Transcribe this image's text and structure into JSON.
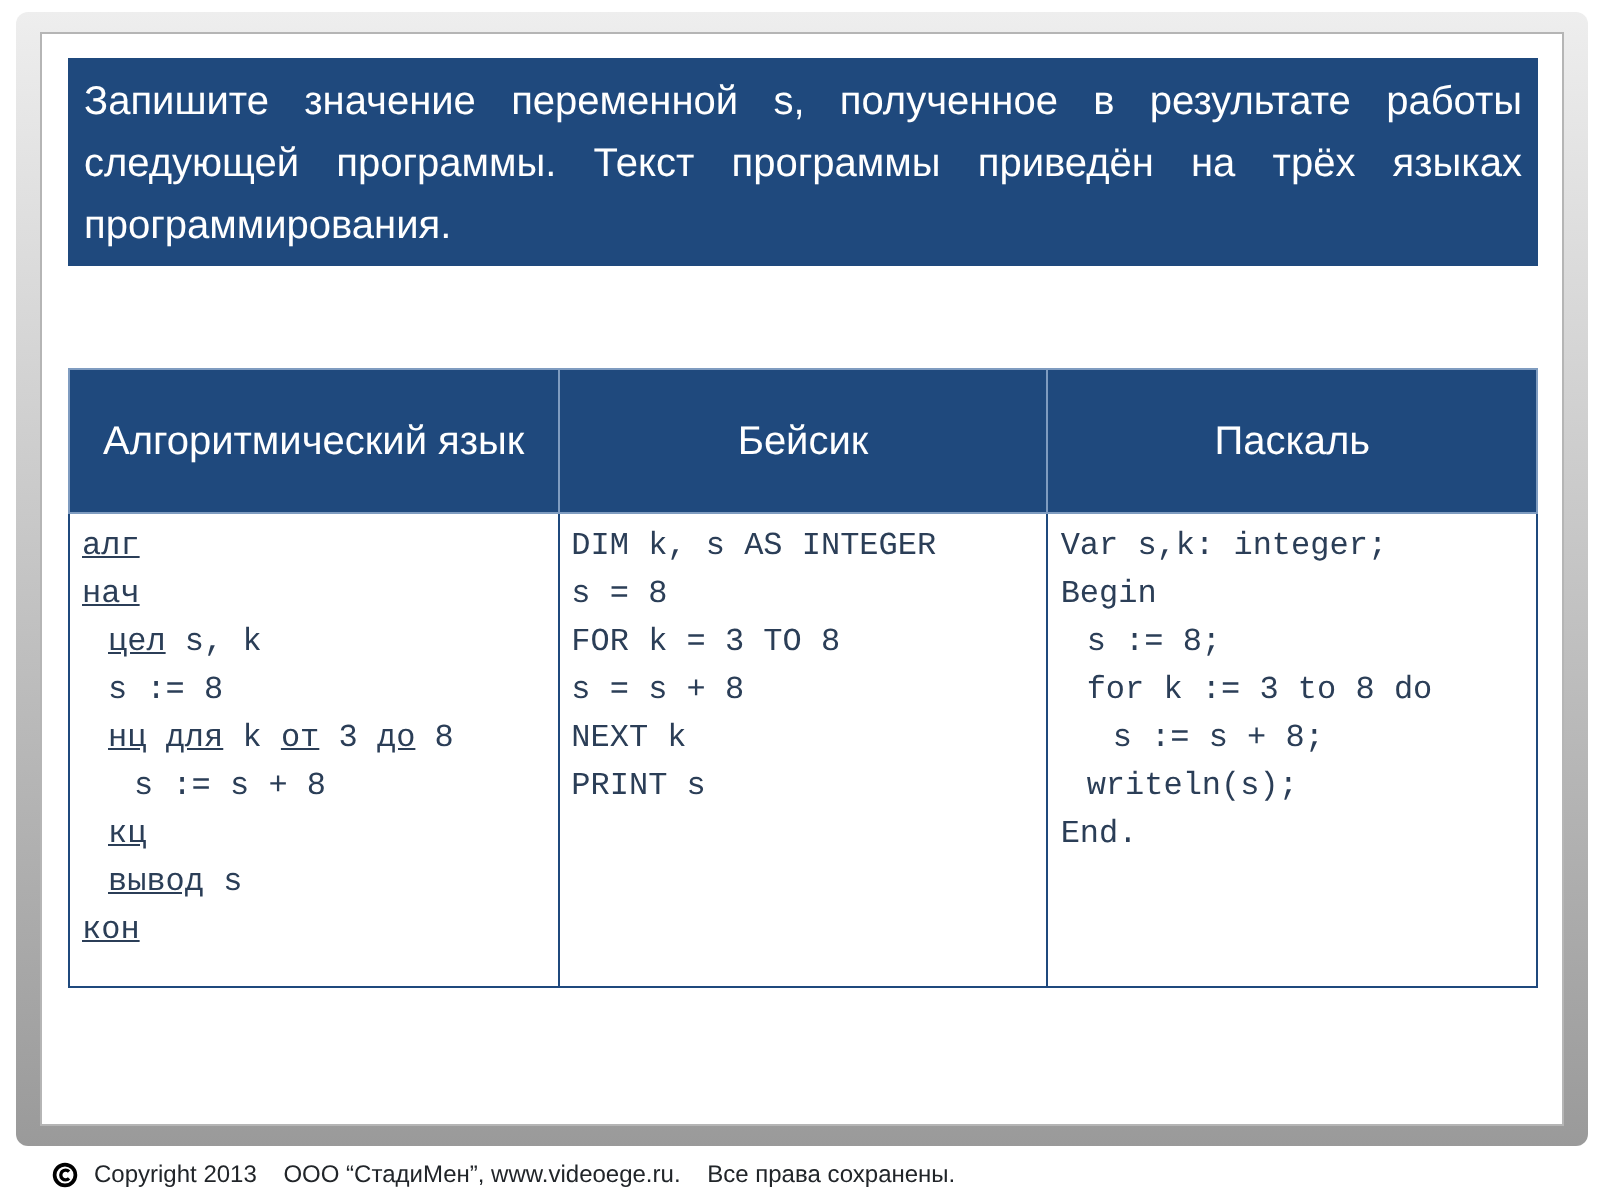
{
  "task": {
    "text": "Запишите значение переменной s, полученное в результате работы следующей программы. Текст программы приведён на трёх языках программирования."
  },
  "table": {
    "columns": [
      "Алгоритмический язык",
      "Бейсик",
      "Паскаль"
    ],
    "cells": [
      {
        "lines": [
          {
            "tokens": [
              {
                "text": "алг",
                "underlined": true
              }
            ]
          },
          {
            "tokens": [
              {
                "text": "нач",
                "underlined": true
              }
            ],
            "children": [
              {
                "tokens": [
                  {
                    "text": "цел",
                    "underlined": true
                  },
                  {
                    "text": "s, k",
                    "underlined": false
                  }
                ]
              },
              {
                "tokens": [
                  {
                    "text": "s := 8",
                    "underlined": false
                  }
                ]
              },
              {
                "tokens": [
                  {
                    "text": "нц",
                    "underlined": true
                  },
                  {
                    "text": "для",
                    "underlined": true
                  },
                  {
                    "text": "k",
                    "underlined": false
                  },
                  {
                    "text": "от",
                    "underlined": true
                  },
                  {
                    "text": "3",
                    "underlined": false
                  },
                  {
                    "text": "до",
                    "underlined": true
                  },
                  {
                    "text": "8",
                    "underlined": false
                  }
                ],
                "children": [
                  {
                    "tokens": [
                      {
                        "text": "s := s + 8",
                        "underlined": false
                      }
                    ]
                  }
                ]
              },
              {
                "tokens": [
                  {
                    "text": "кц",
                    "underlined": true
                  }
                ]
              },
              {
                "tokens": [
                  {
                    "text": "вывод",
                    "underlined": true
                  },
                  {
                    "text": "s",
                    "underlined": false
                  }
                ]
              }
            ]
          },
          {
            "tokens": [
              {
                "text": "кон",
                "underlined": true
              }
            ]
          }
        ]
      },
      {
        "lines": [
          {
            "tokens": [
              {
                "text": "DIM k, s AS INTEGER",
                "underlined": false
              }
            ]
          },
          {
            "tokens": [
              {
                "text": "s = 8",
                "underlined": false
              }
            ]
          },
          {
            "tokens": [
              {
                "text": "FOR k = 3 TO 8",
                "underlined": false
              }
            ]
          },
          {
            "tokens": [
              {
                "text": "s = s + 8",
                "underlined": false
              }
            ]
          },
          {
            "tokens": [
              {
                "text": "NEXT k",
                "underlined": false
              }
            ]
          },
          {
            "tokens": [
              {
                "text": "PRINT s",
                "underlined": false
              }
            ]
          }
        ]
      },
      {
        "lines": [
          {
            "tokens": [
              {
                "text": "Var s,k: integer;",
                "underlined": false
              }
            ]
          },
          {
            "tokens": [
              {
                "text": "Begin",
                "underlined": false
              }
            ],
            "children": [
              {
                "tokens": [
                  {
                    "text": "s := 8;",
                    "underlined": false
                  }
                ]
              },
              {
                "tokens": [
                  {
                    "text": "for k := 3 to 8 do",
                    "underlined": false
                  }
                ],
                "children": [
                  {
                    "tokens": [
                      {
                        "text": "s := s + 8;",
                        "underlined": false
                      }
                    ]
                  }
                ]
              },
              {
                "tokens": [
                  {
                    "text": "writeln(s);",
                    "underlined": false
                  }
                ]
              }
            ]
          },
          {
            "tokens": [
              {
                "text": "End.",
                "underlined": false
              }
            ]
          }
        ]
      }
    ]
  },
  "footer": {
    "text": "Copyright 2013    ООО “СтадиМен”, www.videoege.ru.    Все права сохранены."
  }
}
